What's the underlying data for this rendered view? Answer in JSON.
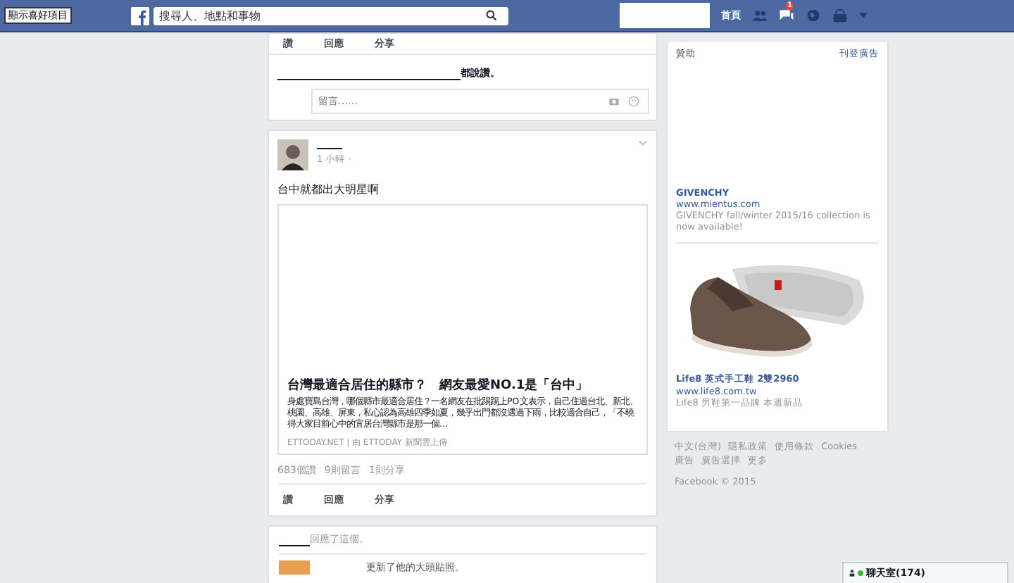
{
  "top_bar": {
    "favorites_button": "顯示喜好項目",
    "search": {
      "placeholder": "搜尋人、地點和事物"
    },
    "home": "首頁",
    "notification_count": "1"
  },
  "feed": [
    {
      "kind": "partial",
      "actions": [
        "讚",
        "回應",
        "分享"
      ],
      "likes_text": "都說讚。",
      "comment": {
        "placeholder": "留言……"
      }
    },
    {
      "kind": "post",
      "time": "1 小時 ·",
      "text": "台中就都出大明星啊",
      "link": {
        "title": "台灣最適合居住的縣市？　網友最愛NO.1是「台中」",
        "description": "身處寶島台灣，哪個縣市最適合居住？一名網友在批踢踢上PO文表示，自己住過台北、新北、桃園、高雄、屏東，私心認為高雄四季如夏，幾乎出門都沒遇過下雨，比較適合自己，「不曉得大家目前心中的宜居台灣縣市是那一個...",
        "source": "ETTODAY.NET | 由 ETTODAY 新聞雲上傳"
      },
      "stats": [
        "683個讚",
        "9則留言",
        "1則分享"
      ],
      "actions": [
        "讚",
        "回應",
        "分享"
      ]
    },
    {
      "kind": "story",
      "header": "回應了這個。",
      "sub": "更新了他的大頭貼照。"
    }
  ],
  "sidebar": {
    "sponsored": "贊助",
    "create_ad": "刊登廣告",
    "ads": [
      {
        "title": "GIVENCHY",
        "url": "www.mientus.com",
        "text": "GIVENCHY fall/winter 2015/16 collection is now available!",
        "kind": "text"
      },
      {
        "title": "Life8 英式手工鞋 2雙2960",
        "url": "www.life8.com.tw",
        "text": "Life8 男鞋第一品牌 本週新品"
      }
    ],
    "footer_links": [
      "中文(台灣)",
      "隱私政策",
      "使用條款",
      "Cookies",
      "廣告",
      "廣告選擇",
      "更多"
    ],
    "copyright": "Facebook © 2015"
  },
  "chat": {
    "label": "聊天室(174)"
  }
}
